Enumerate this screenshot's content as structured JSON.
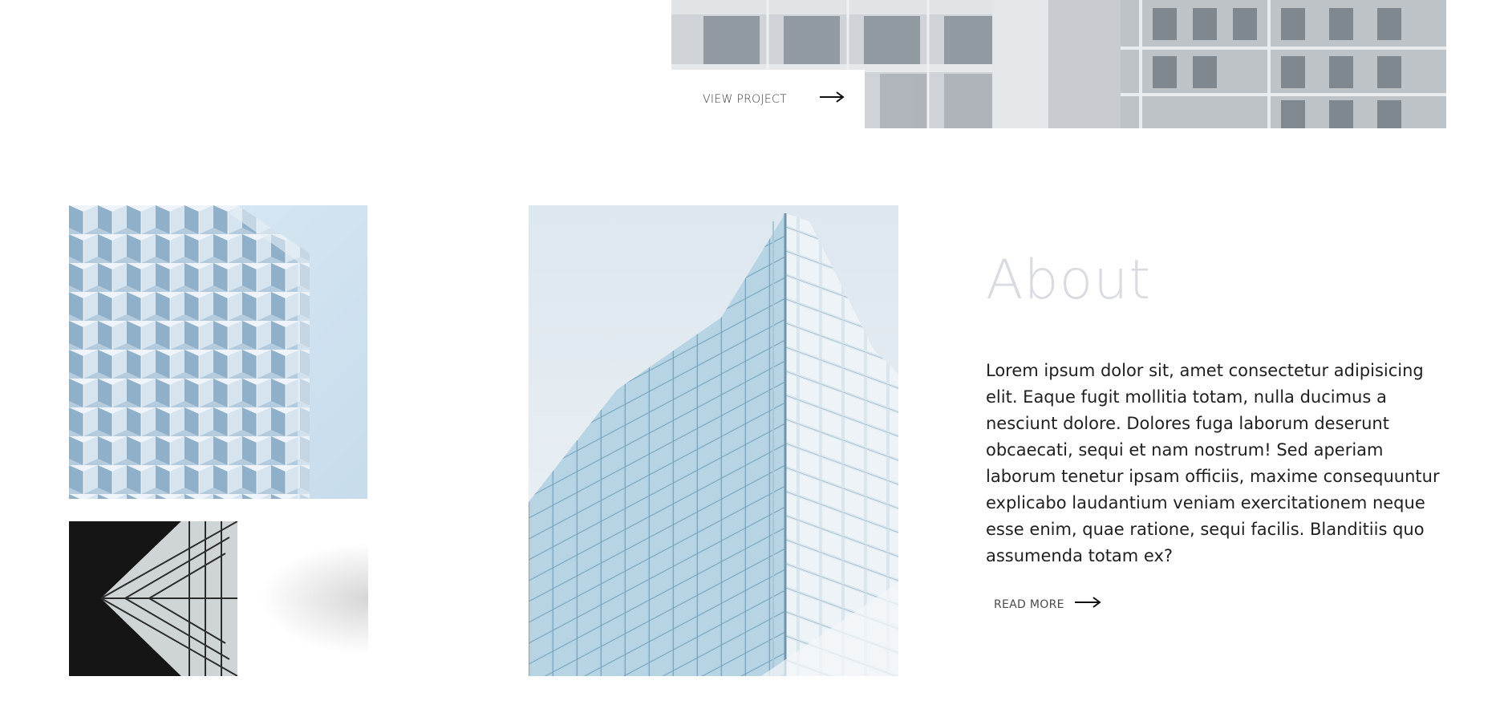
{
  "hero": {
    "view_project_label": "VIEW PROJECT"
  },
  "gallery": {
    "image_1": "building-glass-facade",
    "image_2": "skyscraper-looking-up",
    "image_3": "glass-tower-corner"
  },
  "about": {
    "title": "About",
    "body": "Lorem ipsum dolor sit, amet consectetur adipisicing elit. Eaque fugit mollitia totam, nulla ducimus a nesciunt dolore. Dolores fuga laborum deserunt obcaecati, sequi et nam nostrum! Sed aperiam laborum tenetur ipsam officiis, maxime consequuntur explicabo laudantium veniam exercitationem neque esse enim, quae ratione, sequi facilis. Blanditiis quo assumenda totam ex?",
    "read_more_label": "READ MORE"
  },
  "colors": {
    "about_title": "#d9dbe0",
    "body_text": "#1f1f1f"
  }
}
